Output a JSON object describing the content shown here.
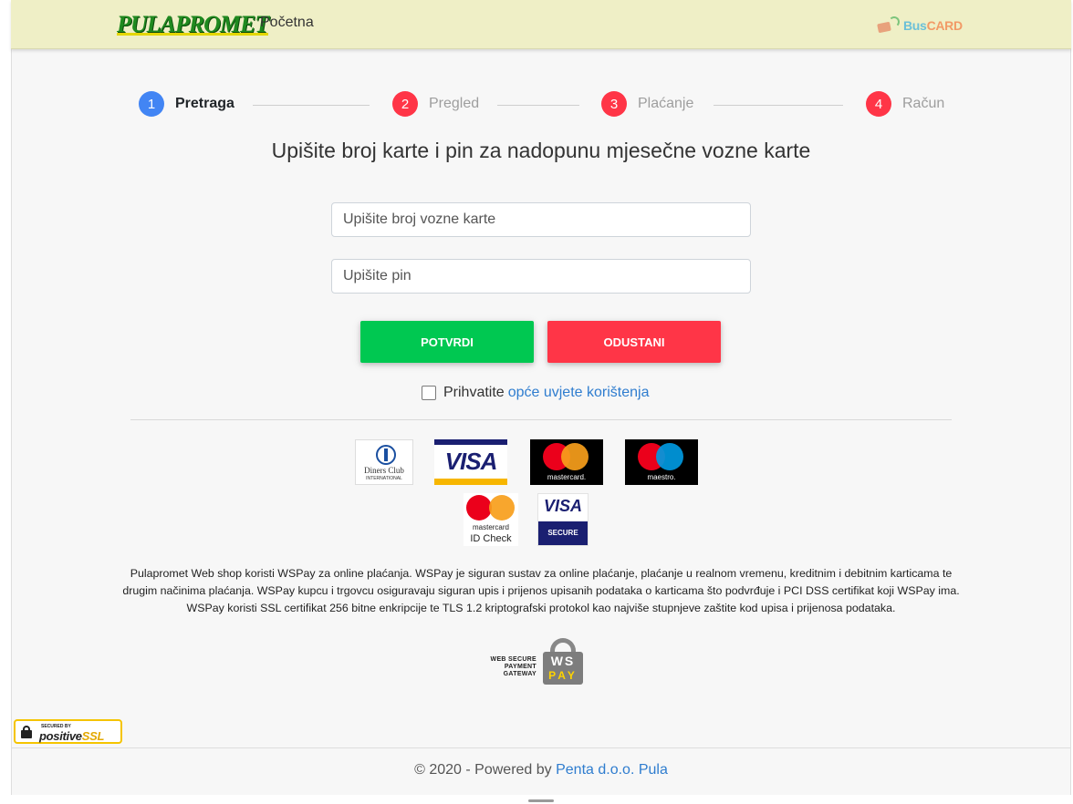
{
  "navbar": {
    "logo_text": "PULAPROMET",
    "home_link": "Početna",
    "buscard_left": "Bus",
    "buscard_right": "CARD",
    "bg_color": "#efefc6"
  },
  "stepper": {
    "steps": [
      {
        "num": "1",
        "label": "Pretraga",
        "state": "active"
      },
      {
        "num": "2",
        "label": "Pregled",
        "state": "pending"
      },
      {
        "num": "3",
        "label": "Plaćanje",
        "state": "pending"
      },
      {
        "num": "4",
        "label": "Račun",
        "state": "pending"
      }
    ]
  },
  "form": {
    "heading": "Upišite broj karte i pin za nadopunu mjesečne vozne karte",
    "card_placeholder": "Upišite broj vozne karte",
    "card_value": "",
    "pin_placeholder": "Upišite pin",
    "pin_value": "",
    "confirm_label": "POTVRDI",
    "cancel_label": "ODUSTANI",
    "terms_prefix": "Prihvatite",
    "terms_link": "opće uvjete korištenja",
    "terms_checked": false
  },
  "payment_logos": {
    "diners_line1": "Diners Club",
    "diners_line2": "INTERNATIONAL",
    "visa": "VISA",
    "mastercard": "mastercard.",
    "maestro": "maestro.",
    "mc_id_line1": "mastercard",
    "mc_id_line2": "ID Check",
    "visa_secure_top": "VISA",
    "visa_secure_bottom": "SECURE"
  },
  "description": "Pulapromet Web shop koristi WSPay za online plaćanja. WSPay je siguran sustav za online plaćanje, plaćanje u realnom vremenu, kreditnim i debitnim karticama te drugim načinima plaćanja. WSPay kupcu i trgovcu osiguravaju siguran upis i prijenos upisanih podataka o karticama što podvrđuje i PCI DSS certifikat koji WSPay ima. WSPay koristi SSL certifikat 256 bitne enkripcije te TLS 1.2 kriptografski protokol kao najviše stupnjeve zaštite kod upisa i prijenosa podataka.",
  "wspay": {
    "line1": "WEB SECURE",
    "line2": "PAYMENT",
    "line3": "GATEWAY",
    "ws": "WS",
    "pay": "PAY"
  },
  "ssl_badge": {
    "secured_by": "SECURED BY",
    "positive": "positive",
    "ssl": "SSL"
  },
  "footer": {
    "prefix": "© 2020 - Powered by ",
    "link": "Penta d.o.o. Pula"
  },
  "colors": {
    "active_step": "#4285f4",
    "pending_step": "#ff3547",
    "confirm": "#00c851",
    "cancel": "#ff3547",
    "link": "#2f7dcf"
  }
}
